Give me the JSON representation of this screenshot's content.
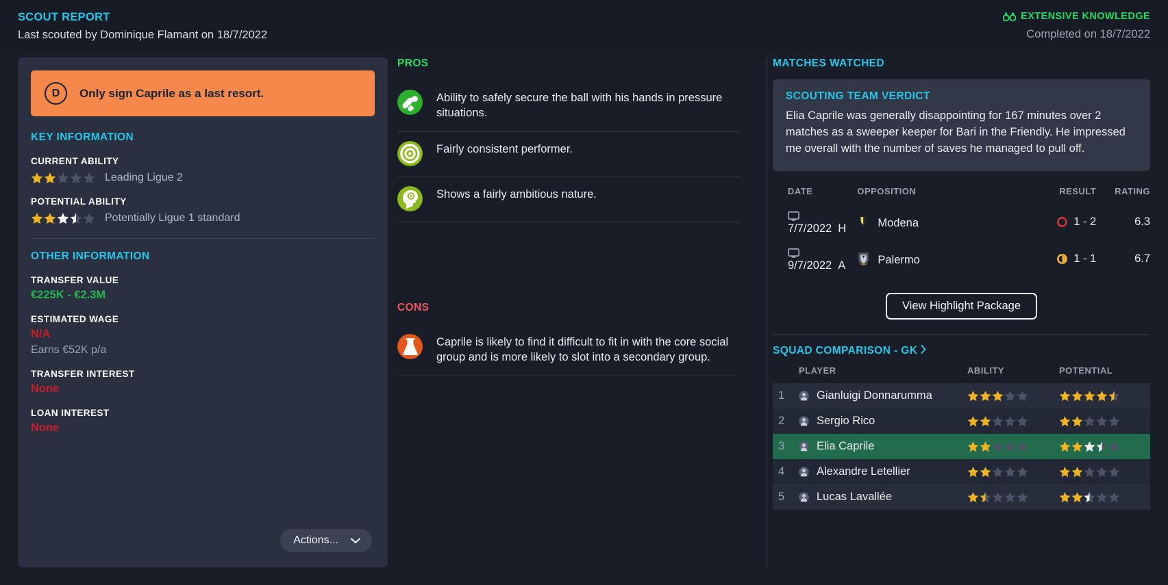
{
  "header": {
    "kicker": "SCOUT REPORT",
    "subtitle": "Last scouted by Dominique Flamant on 18/7/2022",
    "knowledge_label": "EXTENSIVE KNOWLEDGE",
    "knowledge_icon": "binoculars-icon",
    "completed": "Completed on 18/7/2022",
    "colors": {
      "accent": "#26c6e8",
      "green": "#1fdc62",
      "muted": "#9aa3b2"
    }
  },
  "left": {
    "advice": {
      "grade": "D",
      "text": "Only sign Caprile as a last resort.",
      "bg": "#f5884a"
    },
    "key_information_head": "KEY INFORMATION",
    "current_ability": {
      "label": "CURRENT ABILITY",
      "description": "Leading Ligue 2",
      "gold": 2,
      "half_gold": 0,
      "white": 0,
      "half_white": 0,
      "total": 5
    },
    "potential_ability": {
      "label": "POTENTIAL ABILITY",
      "description": "Potentially Ligue 1 standard",
      "gold": 2,
      "half_gold": 0,
      "white": 1,
      "half_white": 1,
      "total": 5
    },
    "other_information_head": "OTHER INFORMATION",
    "fields": [
      {
        "label": "TRANSFER VALUE",
        "value": "€225K - €2.3M",
        "color": "green",
        "sub": ""
      },
      {
        "label": "ESTIMATED WAGE",
        "value": "N/A",
        "color": "red",
        "sub": "Earns €52K p/a"
      },
      {
        "label": "TRANSFER INTEREST",
        "value": "None",
        "color": "red",
        "sub": ""
      },
      {
        "label": "LOAN INTEREST",
        "value": "None",
        "color": "red",
        "sub": ""
      }
    ],
    "actions_label": "Actions...",
    "actions_icon": "chevron-down-icon"
  },
  "middle": {
    "pros_head": "PROS",
    "pros": [
      {
        "icon": "goalkeeper-gloves-icon",
        "color": "#2bb02b",
        "text": "Ability to safely secure the ball with his hands in pressure situations."
      },
      {
        "icon": "target-icon",
        "color": "#8cba1c",
        "text": "Fairly consistent performer."
      },
      {
        "icon": "head-mentality-icon",
        "color": "#8cba1c",
        "text": "Shows a fairly ambitious nature."
      }
    ],
    "cons_head": "CONS",
    "cons": [
      {
        "icon": "flask-icon",
        "color": "#e4591b",
        "text": "Caprile is likely to find it difficult to fit in with the core social group and is more likely to slot into a secondary group."
      }
    ]
  },
  "right": {
    "matches_head": "MATCHES WATCHED",
    "verdict_title": "SCOUTING TEAM VERDICT",
    "verdict_body": "Elia Caprile was generally disappointing for 167 minutes over 2 matches as a sweeper keeper for Bari in the Friendly. He impressed me overall with the number of saves he managed to pull off.",
    "matches_columns": [
      "DATE",
      "OPPOSITION",
      "RESULT",
      "RATING"
    ],
    "matches": [
      {
        "date": "7/7/2022",
        "venue": "H",
        "opposition": "Modena",
        "crest": "modena-crest-icon",
        "result": "1 - 2",
        "outcome": "loss",
        "outcome_color": "#c2323c",
        "rating": "6.3",
        "media_icon": "tv-icon"
      },
      {
        "date": "9/7/2022",
        "venue": "A",
        "opposition": "Palermo",
        "crest": "palermo-crest-icon",
        "result": "1 - 1",
        "outcome": "draw",
        "outcome_color": "#e8b13a",
        "rating": "6.7",
        "media_icon": "tv-icon"
      }
    ],
    "highlight_button": "View Highlight Package",
    "squad_link": "SQUAD COMPARISON - GK",
    "squad_link_icon": "chevron-right-icon",
    "squad_columns": [
      "PLAYER",
      "ABILITY",
      "POTENTIAL"
    ],
    "squad": [
      {
        "rank": "1",
        "name": "Gianluigi Donnarumma",
        "highlighted": false,
        "ability": {
          "gold": 3,
          "half_gold": 0,
          "white": 0,
          "half_white": 0,
          "total": 5
        },
        "potential": {
          "gold": 4,
          "half_gold": 1,
          "white": 0,
          "half_white": 0,
          "total": 5
        }
      },
      {
        "rank": "2",
        "name": "Sergio Rico",
        "highlighted": false,
        "ability": {
          "gold": 2,
          "half_gold": 0,
          "white": 0,
          "half_white": 0,
          "total": 5
        },
        "potential": {
          "gold": 2,
          "half_gold": 0,
          "white": 0,
          "half_white": 0,
          "total": 5
        }
      },
      {
        "rank": "3",
        "name": "Elia Caprile",
        "highlighted": true,
        "ability": {
          "gold": 2,
          "half_gold": 0,
          "white": 0,
          "half_white": 0,
          "total": 5
        },
        "potential": {
          "gold": 2,
          "half_gold": 0,
          "white": 1,
          "half_white": 1,
          "total": 5
        }
      },
      {
        "rank": "4",
        "name": "Alexandre Letellier",
        "highlighted": false,
        "ability": {
          "gold": 2,
          "half_gold": 0,
          "white": 0,
          "half_white": 0,
          "total": 5
        },
        "potential": {
          "gold": 2,
          "half_gold": 0,
          "white": 0,
          "half_white": 0,
          "total": 5
        }
      },
      {
        "rank": "5",
        "name": "Lucas Lavallée",
        "highlighted": false,
        "ability": {
          "gold": 1,
          "half_gold": 1,
          "white": 0,
          "half_white": 0,
          "total": 5
        },
        "potential": {
          "gold": 2,
          "half_gold": 0,
          "white": 0,
          "half_white": 1,
          "total": 5
        }
      }
    ]
  },
  "theme": {
    "star_gold": "#f0b323",
    "star_white": "#f3f5f8",
    "star_empty": "#4b5365",
    "row_highlight": "#226b4c"
  }
}
